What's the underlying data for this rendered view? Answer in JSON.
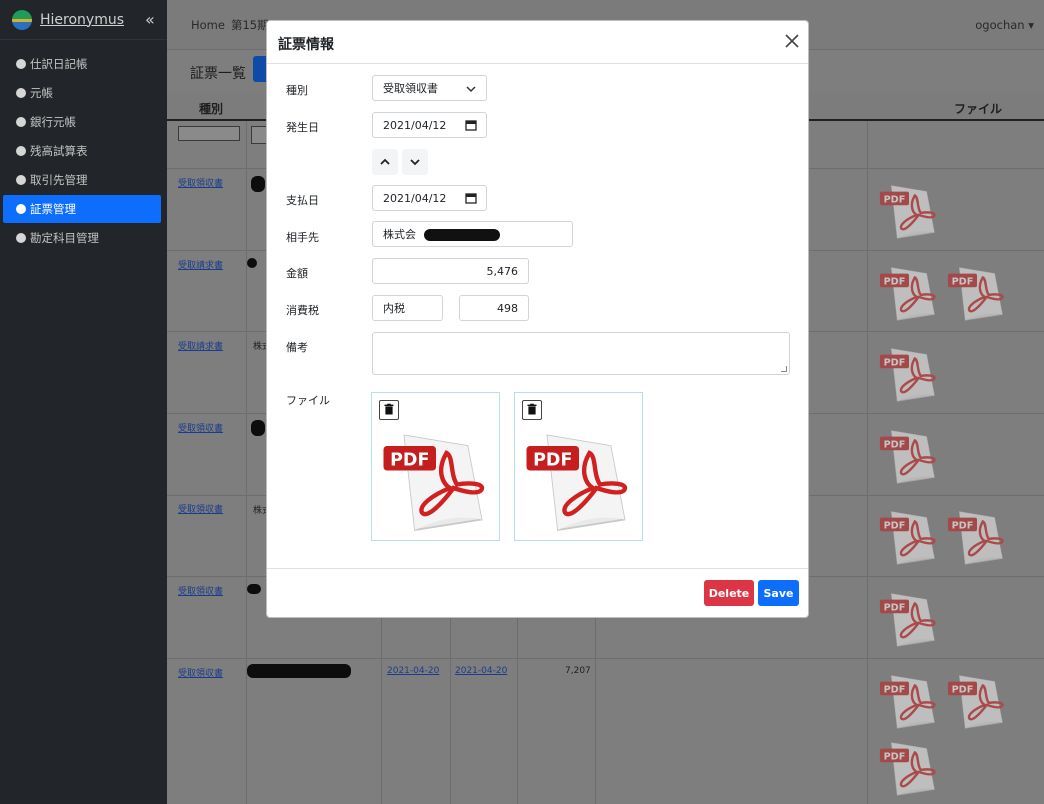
{
  "app": {
    "name": "Hieronymus",
    "collapse_glyph": "«"
  },
  "sidebar": {
    "items": [
      {
        "label": "仕訳日記帳",
        "active": false
      },
      {
        "label": "元帳",
        "active": false
      },
      {
        "label": "銀行元帳",
        "active": false
      },
      {
        "label": "残高試算表",
        "active": false
      },
      {
        "label": "取引先管理",
        "active": false
      },
      {
        "label": "証票管理",
        "active": true
      },
      {
        "label": "勘定科目管理",
        "active": false
      }
    ]
  },
  "topbar": {
    "home": "Home",
    "period": "第15期 (",
    "user": "ogochan ▾"
  },
  "page": {
    "title": "証票一覧"
  },
  "table": {
    "headers": {
      "kind": "種別",
      "file": "ファイル"
    },
    "rows": [
      {
        "kind": "受取領収書"
      },
      {
        "kind": "受取請求書"
      },
      {
        "kind": "受取請求書",
        "partner": "株式"
      },
      {
        "kind": "受取領収書"
      },
      {
        "kind": "受取領収書",
        "partner": "株式"
      },
      {
        "kind": "受取領収書"
      },
      {
        "kind": "受取領収書",
        "date1": "2021-04-20",
        "date2": "2021-04-20",
        "amount": "7,207"
      }
    ]
  },
  "modal": {
    "title": "証票情報",
    "fields": {
      "kind": {
        "label": "種別",
        "value": "受取領収書"
      },
      "issue_date": {
        "label": "発生日",
        "value": "2021/04/12"
      },
      "pay_date": {
        "label": "支払日",
        "value": "2021/04/12"
      },
      "partner": {
        "label": "相手先",
        "value": "株式会"
      },
      "amount": {
        "label": "金額",
        "value": "5,476"
      },
      "tax": {
        "label": "消費税",
        "mode": "内税",
        "value": "498"
      },
      "note": {
        "label": "備考",
        "value": ""
      },
      "file": {
        "label": "ファイル"
      }
    },
    "buttons": {
      "delete": "Delete",
      "save": "Save"
    }
  },
  "icons": {
    "close": "close-icon",
    "calendar": "calendar-icon",
    "trash": "trash-icon",
    "pdf": "pdf-icon",
    "chevron_up": "chevron-up-icon",
    "chevron_down": "chevron-down-icon"
  },
  "colors": {
    "primary": "#0d6efd",
    "danger": "#dc3545",
    "sidebar": "#222529",
    "pdf_red": "#c41e1e"
  }
}
